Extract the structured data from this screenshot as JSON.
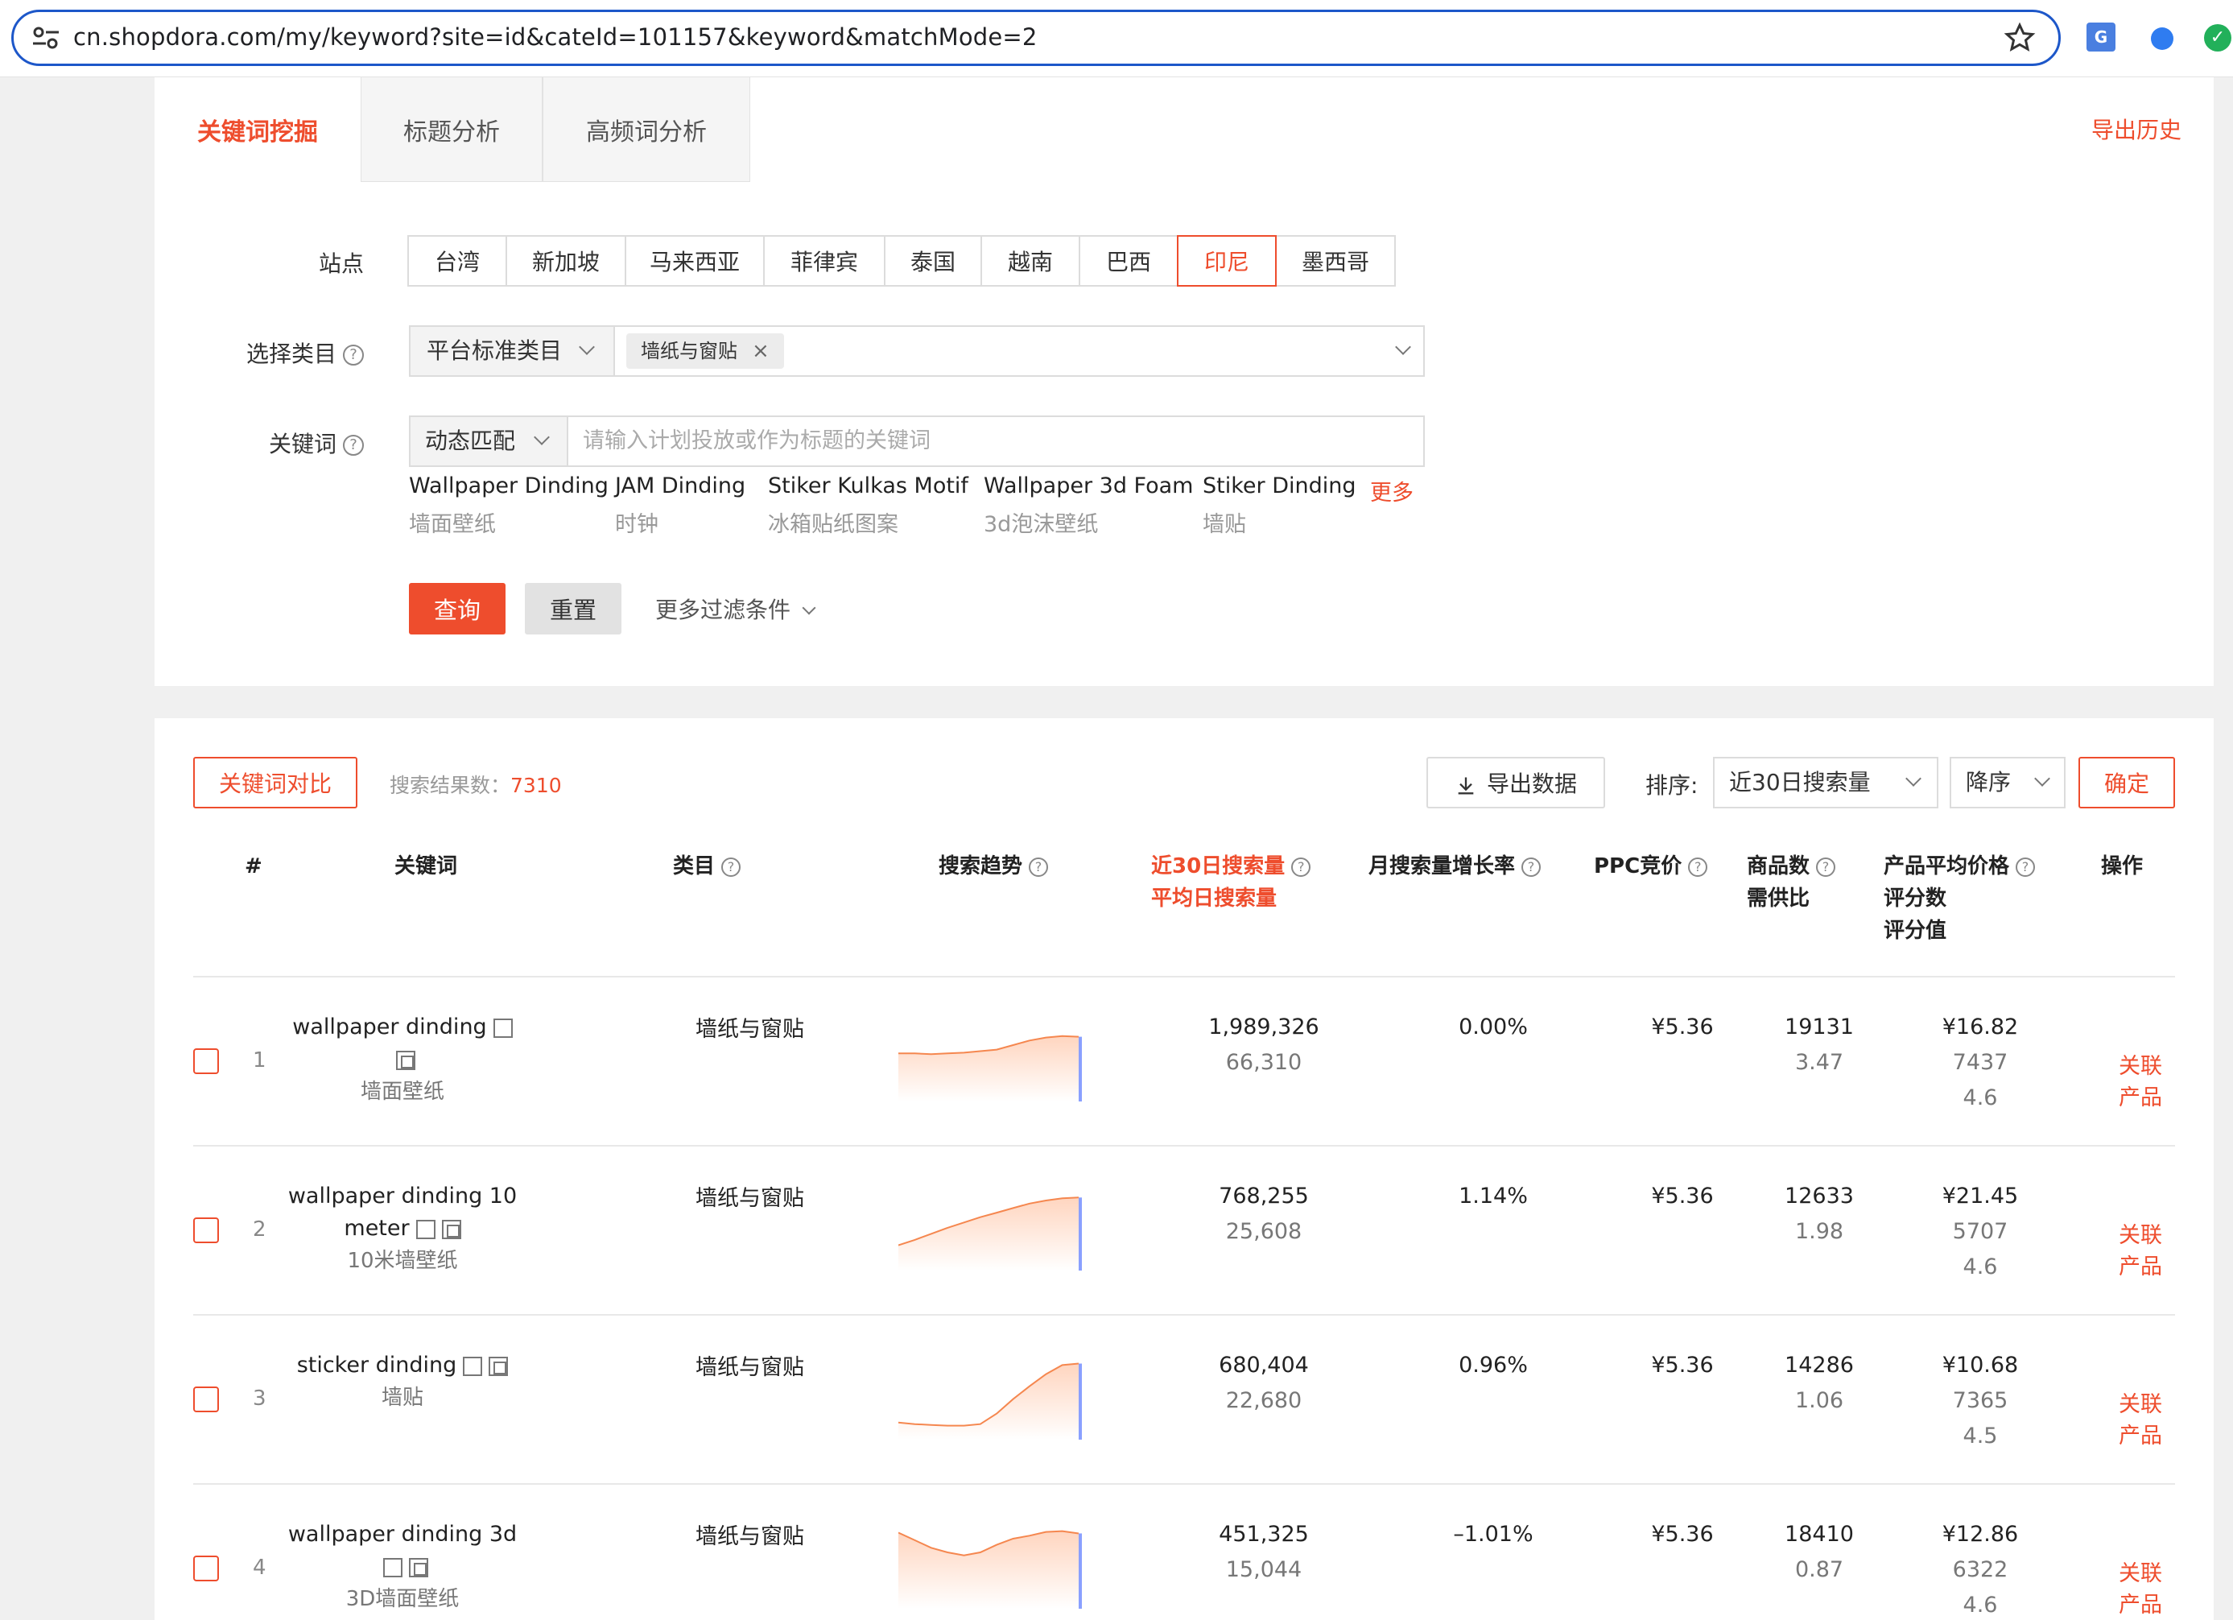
{
  "browser": {
    "url": "cn.shopdora.com/my/keyword?site=id&cateId=101157&keyword&matchMode=2"
  },
  "tabs": [
    {
      "label": "关键词挖掘"
    },
    {
      "label": "标题分析"
    },
    {
      "label": "高频词分析"
    }
  ],
  "export_history": "导出历史",
  "form": {
    "site_label": "站点",
    "sites": [
      "台湾",
      "新加坡",
      "马来西亚",
      "菲律宾",
      "泰国",
      "越南",
      "巴西",
      "印尼",
      "墨西哥"
    ],
    "active_site": "印尼",
    "category_label": "选择类目",
    "category_type": "平台标准类目",
    "category_tag": "墙纸与窗贴",
    "keyword_label": "关键词",
    "match_mode": "动态匹配",
    "keyword_placeholder": "请输入计划投放或作为标题的关键词",
    "suggestions": [
      {
        "en": "Wallpaper Dinding",
        "cn": "墙面壁纸"
      },
      {
        "en": "JAM Dinding",
        "cn": "时钟"
      },
      {
        "en": "Stiker Kulkas Motif",
        "cn": "冰箱贴纸图案"
      },
      {
        "en": "Wallpaper 3d Foam",
        "cn": "3d泡沫壁纸"
      },
      {
        "en": "Stiker Dinding",
        "cn": "墙贴"
      }
    ],
    "more": "更多",
    "query_btn": "查询",
    "reset_btn": "重置",
    "more_filters": "更多过滤条件"
  },
  "results": {
    "compare_btn": "关键词对比",
    "count_label": "搜索结果数：",
    "count": "7310",
    "export_btn": "导出数据",
    "sort_label": "排序:",
    "sort_field": "近30日搜索量",
    "sort_order": "降序",
    "confirm_btn": "确定",
    "headers": {
      "idx": "#",
      "keyword": "关键词",
      "category": "类目",
      "trend": "搜索趋势",
      "search30": "近30日搜索量",
      "daily": "平均日搜索量",
      "growth": "月搜索量增长率",
      "ppc": "PPC竞价",
      "products": "商品数",
      "ratio": "需供比",
      "avg_price": "产品平均价格",
      "reviews": "评分数",
      "rating": "评分值",
      "action": "操作"
    },
    "rows": [
      {
        "idx": "1",
        "kw": "wallpaper dinding",
        "kw_cn": "墙面壁纸",
        "category": "墙纸与窗贴",
        "search30": "1,989,326",
        "daily": "66,310",
        "growth": "0.00%",
        "ppc": "¥5.36",
        "products": "19131",
        "ratio": "3.47",
        "price": "¥16.82",
        "reviews": "7437",
        "rating": "4.6",
        "action": "关联产品",
        "trend": [
          0.55,
          0.55,
          0.54,
          0.55,
          0.56,
          0.58,
          0.6,
          0.66,
          0.72,
          0.76,
          0.78,
          0.77
        ]
      },
      {
        "idx": "2",
        "kw": "wallpaper dinding 10 meter",
        "kw_cn": "10米墙壁纸",
        "category": "墙纸与窗贴",
        "search30": "768,255",
        "daily": "25,608",
        "growth": "1.14%",
        "ppc": "¥5.36",
        "products": "12633",
        "ratio": "1.98",
        "price": "¥21.45",
        "reviews": "5707",
        "rating": "4.6",
        "action": "关联产品",
        "trend": [
          0.25,
          0.32,
          0.4,
          0.48,
          0.55,
          0.62,
          0.68,
          0.74,
          0.8,
          0.84,
          0.87,
          0.88
        ]
      },
      {
        "idx": "3",
        "kw": "sticker dinding",
        "kw_cn": "墙贴",
        "category": "墙纸与窗贴",
        "search30": "680,404",
        "daily": "22,680",
        "growth": "0.96%",
        "ppc": "¥5.36",
        "products": "14286",
        "ratio": "1.06",
        "price": "¥10.68",
        "reviews": "7365",
        "rating": "4.5",
        "action": "关联产品",
        "trend": [
          0.14,
          0.12,
          0.11,
          0.1,
          0.1,
          0.12,
          0.26,
          0.45,
          0.62,
          0.78,
          0.9,
          0.92
        ]
      },
      {
        "idx": "4",
        "kw": "wallpaper dinding 3d",
        "kw_cn": "3D墙面壁纸",
        "category": "墙纸与窗贴",
        "search30": "451,325",
        "daily": "15,044",
        "growth": "–1.01%",
        "ppc": "¥5.36",
        "products": "18410",
        "ratio": "0.87",
        "price": "¥12.86",
        "reviews": "6322",
        "rating": "4.6",
        "action": "关联产品",
        "trend": [
          0.92,
          0.82,
          0.72,
          0.66,
          0.62,
          0.66,
          0.76,
          0.84,
          0.88,
          0.93,
          0.94,
          0.91
        ]
      }
    ]
  },
  "colors": {
    "accent": "#ee4d2d",
    "url_border": "#1d57c9"
  },
  "icons": [
    "tune-icon",
    "star-icon",
    "translate-icon",
    "help-icon",
    "chevron-down-icon",
    "close-icon",
    "download-icon",
    "external-link-icon",
    "copy-icon"
  ]
}
